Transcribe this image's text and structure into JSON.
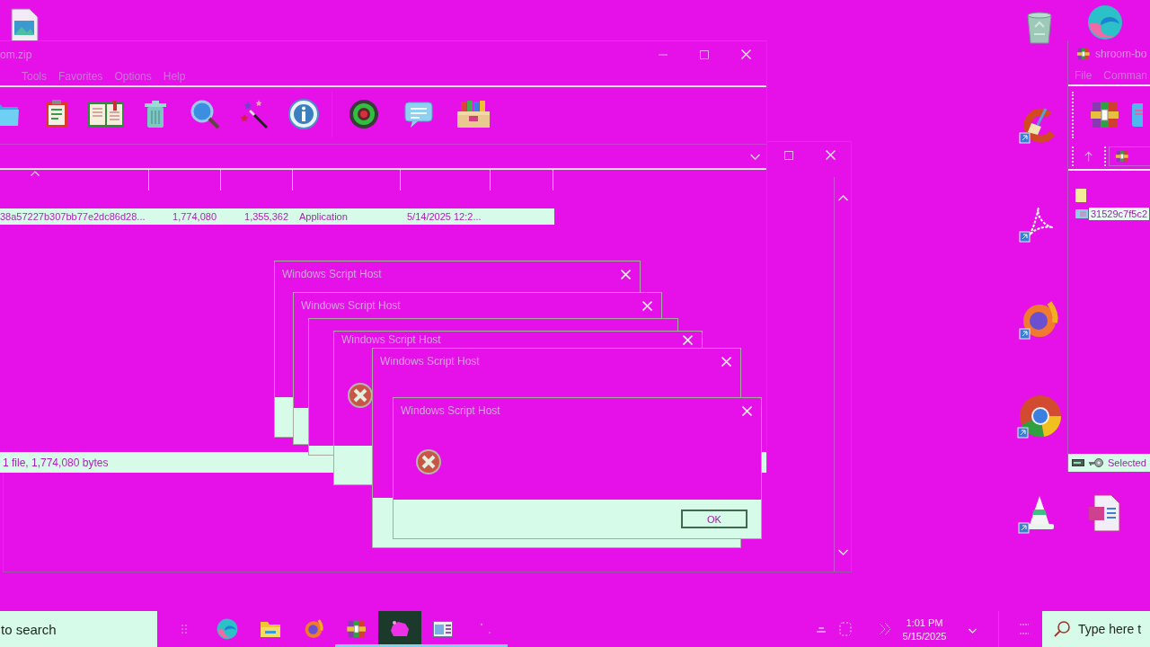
{
  "archive_window": {
    "title": "om.zip",
    "menu": [
      "Tools",
      "Favorites",
      "Options",
      "Help"
    ],
    "rows": [
      {
        "cells": [
          "38a57227b307bb77e2dc86d28...",
          "1,774,080",
          "1,355,362",
          "Application",
          "5/14/2025 12:2..."
        ],
        "selected": true
      }
    ],
    "status": "1 file, 1,774,080 bytes"
  },
  "dialogs": [
    {
      "title": "Windows Script Host"
    },
    {
      "title": "Windows Script Host"
    },
    {
      "title": "Windows Script Host"
    },
    {
      "title": "Windows Script Host"
    },
    {
      "title": "Windows Script Host",
      "buttons": [
        "OK"
      ]
    }
  ],
  "side_window": {
    "title": "shroom-bo",
    "menu": [
      "File",
      "Comman"
    ],
    "rows": [
      {
        "name": "31529c7f5c2",
        "selected": true
      }
    ],
    "status": "Selected"
  },
  "taskbar": {
    "search": {
      "placeholder": "to search"
    },
    "apps": [
      {
        "selected": false,
        "running": false
      },
      {
        "selected": false,
        "running": false
      },
      {
        "selected": false,
        "running": false
      },
      {
        "selected": false,
        "running": true
      },
      {
        "selected": true,
        "running": true
      },
      {
        "selected": false,
        "running": true
      },
      {
        "selected": false,
        "running": true
      }
    ],
    "clock": {
      "time": "1:01 PM",
      "date": "5/15/2025"
    },
    "tray_search": {
      "placeholder": "Type here t"
    }
  }
}
